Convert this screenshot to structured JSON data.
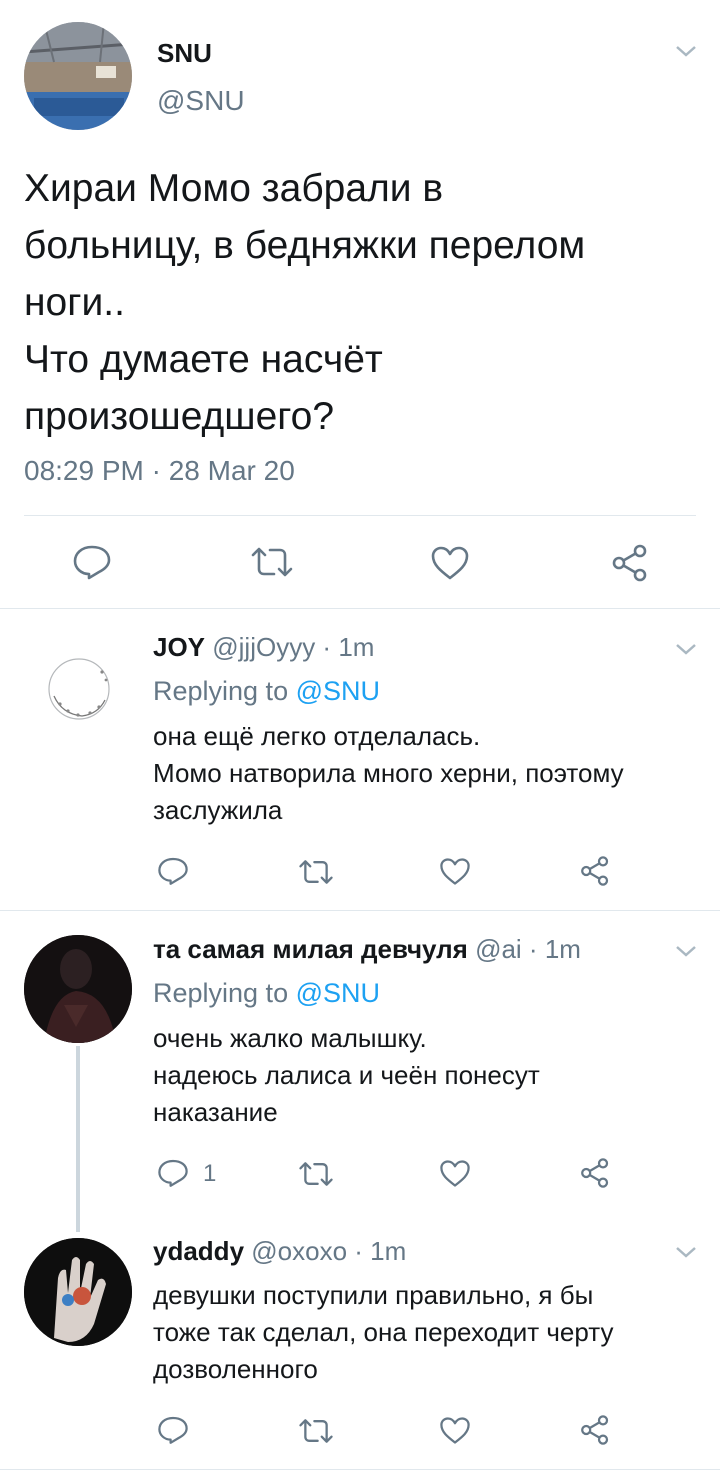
{
  "main_tweet": {
    "display_name": "SNU",
    "handle": "@SNU",
    "text_lines": [
      "Хираи Момо забрали в",
      "больницу, в бедняжки перелом",
      "ноги..",
      "Что думаете насчёт",
      "произошедшего?"
    ],
    "timestamp": "08:29 PM · 28 Mar 20",
    "avatar_icon": "gym-avatar-photo"
  },
  "replies": [
    {
      "display_name": "JOY",
      "handle_meta": "@jjjOyyy · 1m",
      "replying_prefix": "Replying to ",
      "replying_to": "@SNU",
      "text_lines": [
        "она ещё легко отделалась.",
        "Момо натворила много херни, поэтому",
        "заслужила"
      ],
      "reply_count": ""
    },
    {
      "display_name": "та самая милая девчуля",
      "handle_meta": "@ai · 1m",
      "replying_prefix": "Replying to ",
      "replying_to": "@SNU",
      "text_lines": [
        "очень жалко малышку.",
        "надеюсь лалиса и чеён понесут",
        "наказание"
      ],
      "reply_count": "1"
    },
    {
      "display_name": "ydaddy",
      "handle_meta": "@oxoxo · 1m",
      "text_lines": [
        "девушки поступили правильно, я бы",
        "тоже так сделал, она переходит черту",
        "дозволенного"
      ],
      "reply_count": ""
    }
  ],
  "colors": {
    "accent": "#1da1f2",
    "secondary_text": "#657786",
    "divider": "#e1e8ed",
    "icon": "#657786"
  }
}
